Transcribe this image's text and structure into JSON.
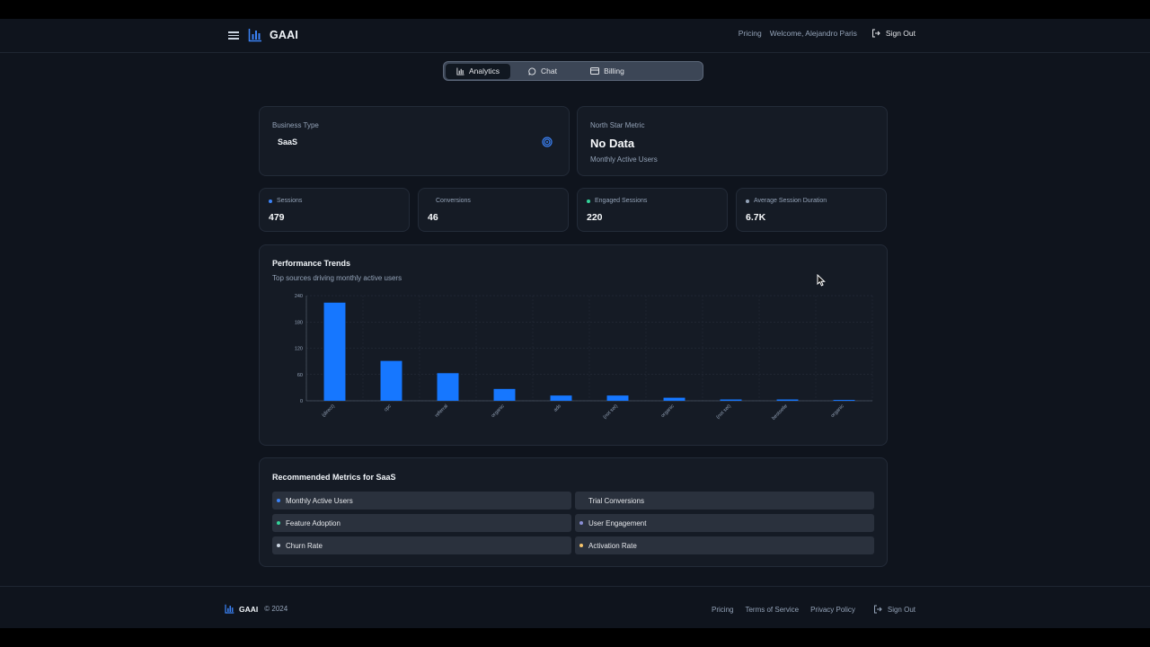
{
  "header": {
    "brand": "GAAI",
    "pricing": "Pricing",
    "welcome": "Welcome, Alejandro Paris",
    "sign_out": "Sign Out"
  },
  "tabs": [
    {
      "label": "Analytics",
      "icon": "bar-chart-icon",
      "active": true
    },
    {
      "label": "Chat",
      "icon": "chat-bubble-icon",
      "active": false
    },
    {
      "label": "Billing",
      "icon": "credit-card-icon",
      "active": false
    }
  ],
  "business_type": {
    "label": "Business Type",
    "value": "SaaS",
    "icon": "target-icon"
  },
  "north_star": {
    "label": "North Star Metric",
    "value": "No Data",
    "sub": "Monthly Active Users"
  },
  "stats": [
    {
      "label": "Sessions",
      "value": "479",
      "color": "#3b82f6"
    },
    {
      "label": "Conversions",
      "value": "46",
      "color": ""
    },
    {
      "label": "Engaged Sessions",
      "value": "220",
      "color": "#34d399"
    },
    {
      "label": "Average Session Duration",
      "value": "6.7K",
      "color": "#94a3b8"
    }
  ],
  "performance": {
    "title": "Performance Trends",
    "subtitle": "Top sources driving monthly active users"
  },
  "chart_data": {
    "type": "bar",
    "categories": [
      "(direct)",
      "cpc",
      "referral",
      "organic",
      "ads",
      "(not set)",
      "organic",
      "(not set)",
      "bestselle",
      "organic"
    ],
    "values": [
      224,
      91,
      63,
      27,
      12,
      12,
      7,
      3,
      3,
      2
    ],
    "yticks": [
      "0",
      "60",
      "120",
      "180",
      "240"
    ],
    "ylim": [
      0,
      240
    ],
    "grid": true,
    "bar_color": "#1677ff",
    "title": "",
    "xlabel": "",
    "ylabel": ""
  },
  "recommended": {
    "title": "Recommended Metrics for SaaS",
    "items": [
      {
        "label": "Monthly Active Users",
        "color": "#3b82f6"
      },
      {
        "label": "Trial Conversions",
        "color": ""
      },
      {
        "label": "Feature Adoption",
        "color": "#34d399"
      },
      {
        "label": "User Engagement",
        "color": "#8b8fd6"
      },
      {
        "label": "Churn Rate",
        "color": "#cbd5e1"
      },
      {
        "label": "Activation Rate",
        "color": "#f6c46c"
      }
    ]
  },
  "footer": {
    "brand": "GAAI",
    "copyright": "© 2024",
    "pricing": "Pricing",
    "terms": "Terms of Service",
    "privacy": "Privacy Policy",
    "sign_out": "Sign Out"
  },
  "colors": {
    "accent": "#1677ff",
    "background": "#0f141d",
    "card": "#151b25"
  }
}
